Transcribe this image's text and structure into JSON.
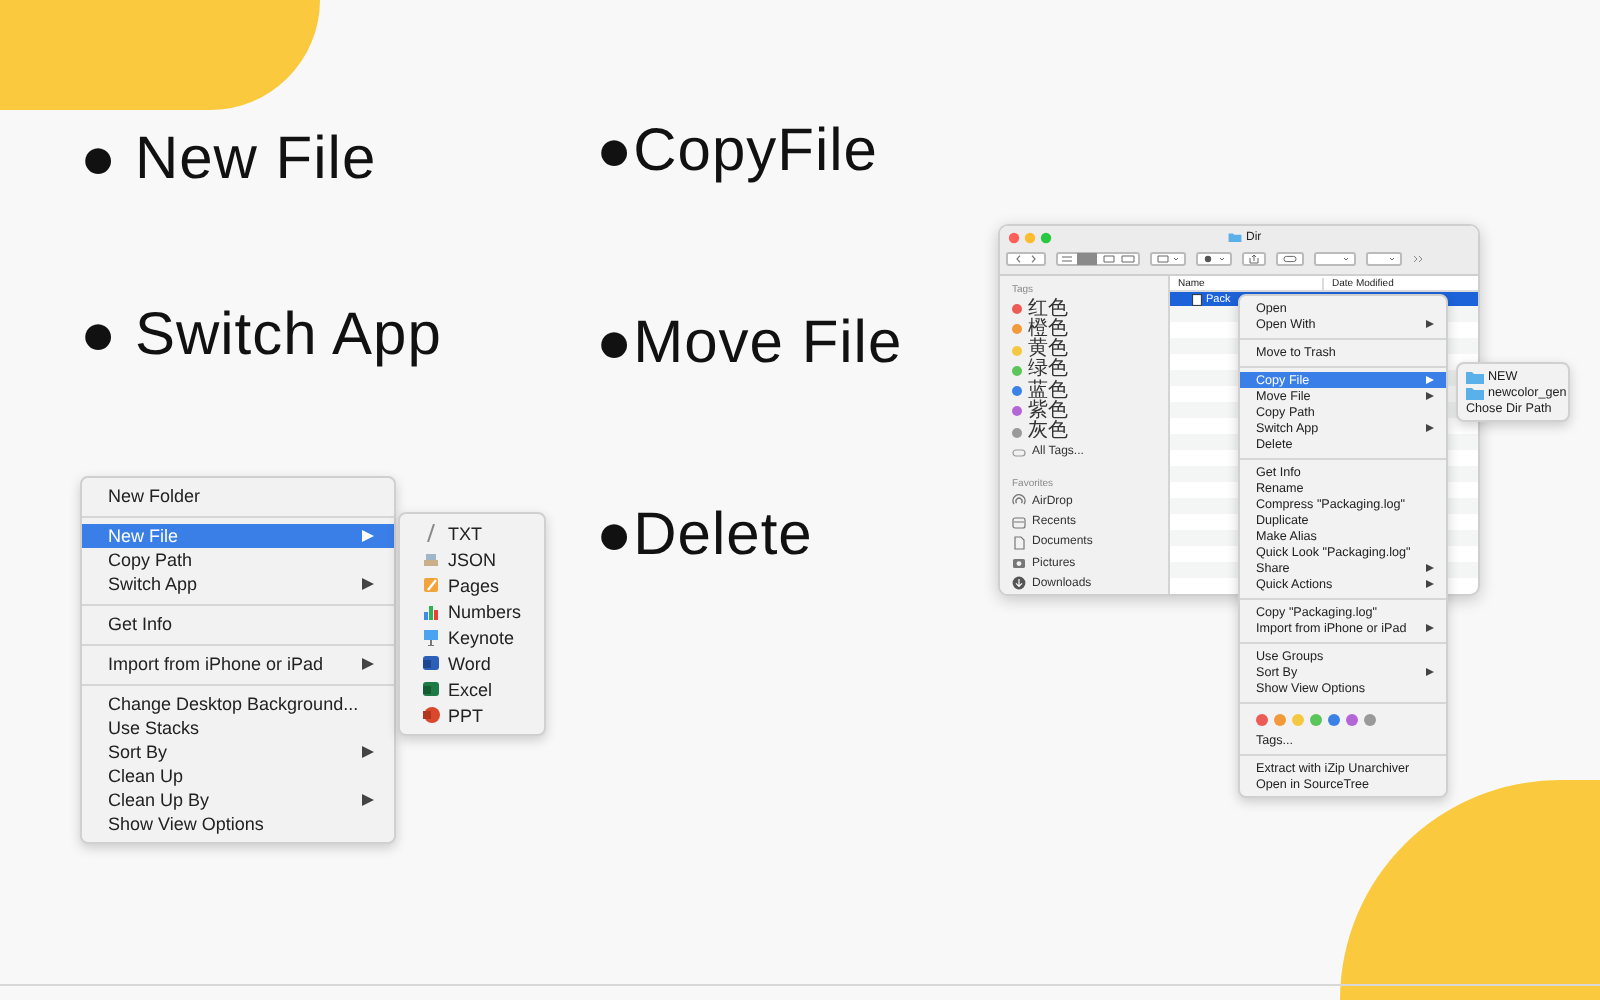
{
  "features_left": [
    {
      "label": "● New File"
    },
    {
      "label": "● Switch App"
    }
  ],
  "features_right": [
    {
      "label": "●CopyFile"
    },
    {
      "label": "●Move File"
    },
    {
      "label": "●Delete"
    }
  ],
  "desktop_menu": {
    "items": [
      {
        "kind": "item",
        "label": "New Folder",
        "selected": false,
        "submenu": false
      },
      {
        "kind": "separator"
      },
      {
        "kind": "item",
        "label": "New File",
        "selected": true,
        "submenu": true
      },
      {
        "kind": "item",
        "label": "Copy Path",
        "selected": false,
        "submenu": false
      },
      {
        "kind": "item",
        "label": "Switch App",
        "selected": false,
        "submenu": true
      },
      {
        "kind": "separator"
      },
      {
        "kind": "item",
        "label": "Get Info",
        "selected": false,
        "submenu": false
      },
      {
        "kind": "separator"
      },
      {
        "kind": "item",
        "label": "Import from iPhone or iPad",
        "selected": false,
        "submenu": true
      },
      {
        "kind": "separator"
      },
      {
        "kind": "item",
        "label": "Change Desktop Background...",
        "selected": false,
        "submenu": false
      },
      {
        "kind": "item",
        "label": "Use Stacks",
        "selected": false,
        "submenu": false
      },
      {
        "kind": "item",
        "label": "Sort By",
        "selected": false,
        "submenu": true
      },
      {
        "kind": "item",
        "label": "Clean Up",
        "selected": false,
        "submenu": false
      },
      {
        "kind": "item",
        "label": "Clean Up By",
        "selected": false,
        "submenu": true
      },
      {
        "kind": "item",
        "label": "Show View Options",
        "selected": false,
        "submenu": false
      }
    ]
  },
  "new_file_submenu": {
    "items": [
      {
        "kind": "txt",
        "label": "TXT"
      },
      {
        "kind": "json",
        "label": "JSON"
      },
      {
        "kind": "pages",
        "label": "Pages"
      },
      {
        "kind": "numbers",
        "label": "Numbers"
      },
      {
        "kind": "keynote",
        "label": "Keynote"
      },
      {
        "kind": "word",
        "label": "Word"
      },
      {
        "kind": "excel",
        "label": "Excel"
      },
      {
        "kind": "ppt",
        "label": "PPT"
      }
    ]
  },
  "finder": {
    "title": "Dir",
    "sidebar": {
      "tags_heading": "Tags",
      "tags": [
        {
          "label": "红色",
          "color": "#ec5b56"
        },
        {
          "label": "橙色",
          "color": "#f29a3a"
        },
        {
          "label": "黄色",
          "color": "#f5c842"
        },
        {
          "label": "绿色",
          "color": "#5bc55a"
        },
        {
          "label": "蓝色",
          "color": "#3b82e8"
        },
        {
          "label": "紫色",
          "color": "#b466d6"
        },
        {
          "label": "灰色",
          "color": "#9a9a9a"
        }
      ],
      "all_tags": "All Tags...",
      "favorites_heading": "Favorites",
      "favorites": [
        {
          "kind": "airdrop",
          "label": "AirDrop"
        },
        {
          "kind": "recents",
          "label": "Recents"
        },
        {
          "kind": "documents",
          "label": "Documents"
        },
        {
          "kind": "pictures",
          "label": "Pictures"
        },
        {
          "kind": "downloads",
          "label": "Downloads"
        }
      ]
    },
    "columns": [
      "Name",
      "Date Modified"
    ],
    "rows": [
      {
        "name": "Pack",
        "selected": true
      }
    ]
  },
  "file_menu": {
    "items": [
      {
        "kind": "item",
        "label": "Open",
        "selected": false,
        "submenu": false
      },
      {
        "kind": "item",
        "label": "Open With",
        "selected": false,
        "submenu": true
      },
      {
        "kind": "separator"
      },
      {
        "kind": "item",
        "label": "Move to Trash",
        "selected": false,
        "submenu": false
      },
      {
        "kind": "separator"
      },
      {
        "kind": "item",
        "label": "Copy File",
        "selected": true,
        "submenu": true
      },
      {
        "kind": "item",
        "label": "Move File",
        "selected": false,
        "submenu": true
      },
      {
        "kind": "item",
        "label": "Copy Path",
        "selected": false,
        "submenu": false
      },
      {
        "kind": "item",
        "label": "Switch App",
        "selected": false,
        "submenu": true
      },
      {
        "kind": "item",
        "label": "Delete",
        "selected": false,
        "submenu": false
      },
      {
        "kind": "separator"
      },
      {
        "kind": "item",
        "label": "Get Info",
        "selected": false,
        "submenu": false
      },
      {
        "kind": "item",
        "label": "Rename",
        "selected": false,
        "submenu": false
      },
      {
        "kind": "item",
        "label": "Compress \"Packaging.log\"",
        "selected": false,
        "submenu": false
      },
      {
        "kind": "item",
        "label": "Duplicate",
        "selected": false,
        "submenu": false
      },
      {
        "kind": "item",
        "label": "Make Alias",
        "selected": false,
        "submenu": false
      },
      {
        "kind": "item",
        "label": "Quick Look \"Packaging.log\"",
        "selected": false,
        "submenu": false
      },
      {
        "kind": "item",
        "label": "Share",
        "selected": false,
        "submenu": true
      },
      {
        "kind": "item",
        "label": "Quick Actions",
        "selected": false,
        "submenu": true
      },
      {
        "kind": "separator"
      },
      {
        "kind": "item",
        "label": "Copy \"Packaging.log\"",
        "selected": false,
        "submenu": false
      },
      {
        "kind": "item",
        "label": "Import from iPhone or iPad",
        "selected": false,
        "submenu": true
      },
      {
        "kind": "separator"
      },
      {
        "kind": "item",
        "label": "Use Groups",
        "selected": false,
        "submenu": false
      },
      {
        "kind": "item",
        "label": "Sort By",
        "selected": false,
        "submenu": true
      },
      {
        "kind": "item",
        "label": "Show View Options",
        "selected": false,
        "submenu": false
      },
      {
        "kind": "separator"
      },
      {
        "kind": "colors",
        "colors": [
          {
            "color": "#ec5b56"
          },
          {
            "color": "#f29a3a"
          },
          {
            "color": "#f5c842"
          },
          {
            "color": "#5bc55a"
          },
          {
            "color": "#3b82e8"
          },
          {
            "color": "#b466d6"
          },
          {
            "color": "#9a9a9a"
          }
        ]
      },
      {
        "kind": "item",
        "label": "Tags...",
        "selected": false,
        "submenu": false
      },
      {
        "kind": "separator"
      },
      {
        "kind": "item",
        "label": "Extract with iZip Unarchiver",
        "selected": false,
        "submenu": false
      },
      {
        "kind": "item",
        "label": "Open in SourceTree",
        "selected": false,
        "submenu": false
      }
    ]
  },
  "copy_file_submenu": {
    "items": [
      {
        "kind": "folder",
        "label": "NEW"
      },
      {
        "kind": "folder",
        "label": "newcolor_gen"
      },
      {
        "kind": "action",
        "label": "Chose Dir Path"
      }
    ]
  }
}
